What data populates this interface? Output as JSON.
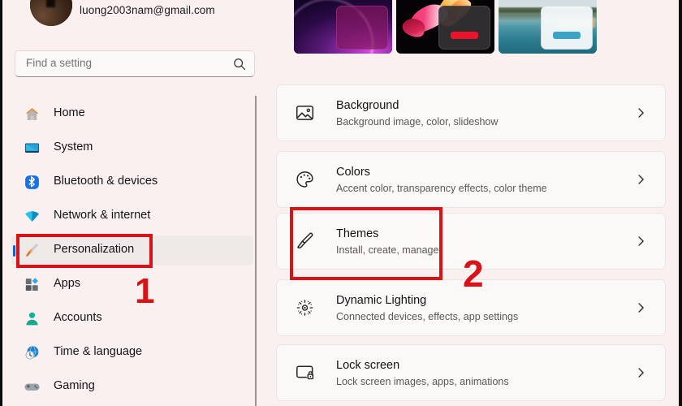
{
  "account": {
    "email": "luong2003nam@gmail.com",
    "name": "",
    "avatar_icon": "user-avatar-photo"
  },
  "search": {
    "placeholder": "Find a setting",
    "value": "",
    "icon": "search-icon"
  },
  "sidebar": {
    "items": [
      {
        "label": "Home",
        "icon": "home-icon",
        "selected": false
      },
      {
        "label": "System",
        "icon": "monitor-icon",
        "selected": false
      },
      {
        "label": "Bluetooth & devices",
        "icon": "bluetooth-icon",
        "selected": false
      },
      {
        "label": "Network & internet",
        "icon": "wifi-icon",
        "selected": false
      },
      {
        "label": "Personalization",
        "icon": "paintbrush-icon",
        "selected": true
      },
      {
        "label": "Apps",
        "icon": "apps-grid-icon",
        "selected": false
      },
      {
        "label": "Accounts",
        "icon": "person-icon",
        "selected": false
      },
      {
        "label": "Time & language",
        "icon": "clock-globe-icon",
        "selected": false
      },
      {
        "label": "Gaming",
        "icon": "gamepad-icon",
        "selected": false
      }
    ]
  },
  "themes": {
    "thumbnails": [
      {
        "name": "purple-glow-theme",
        "accent_color": "#9b2fb3"
      },
      {
        "name": "dark-flower-theme",
        "accent_color": "#e8142c"
      },
      {
        "name": "light-lake-theme",
        "accent_color": "#3ba3c4"
      }
    ]
  },
  "settings_rows": [
    {
      "title": "Background",
      "subtitle": "Background image, color, slideshow",
      "icon": "picture-icon",
      "chevron": "chevron-right-icon"
    },
    {
      "title": "Colors",
      "subtitle": "Accent color, transparency effects, color theme",
      "icon": "palette-icon",
      "chevron": "chevron-right-icon"
    },
    {
      "title": "Themes",
      "subtitle": "Install, create, manage",
      "icon": "paintbrush-icon",
      "chevron": "chevron-right-icon"
    },
    {
      "title": "Dynamic Lighting",
      "subtitle": "Connected devices, effects, app settings",
      "icon": "dynamic-lighting-icon",
      "chevron": "chevron-right-icon"
    },
    {
      "title": "Lock screen",
      "subtitle": "Lock screen images, apps, animations",
      "icon": "lock-screen-icon",
      "chevron": "chevron-right-icon"
    }
  ],
  "annotations": {
    "step_one": "1",
    "step_two": "2",
    "highlight_color": "#d81216"
  }
}
